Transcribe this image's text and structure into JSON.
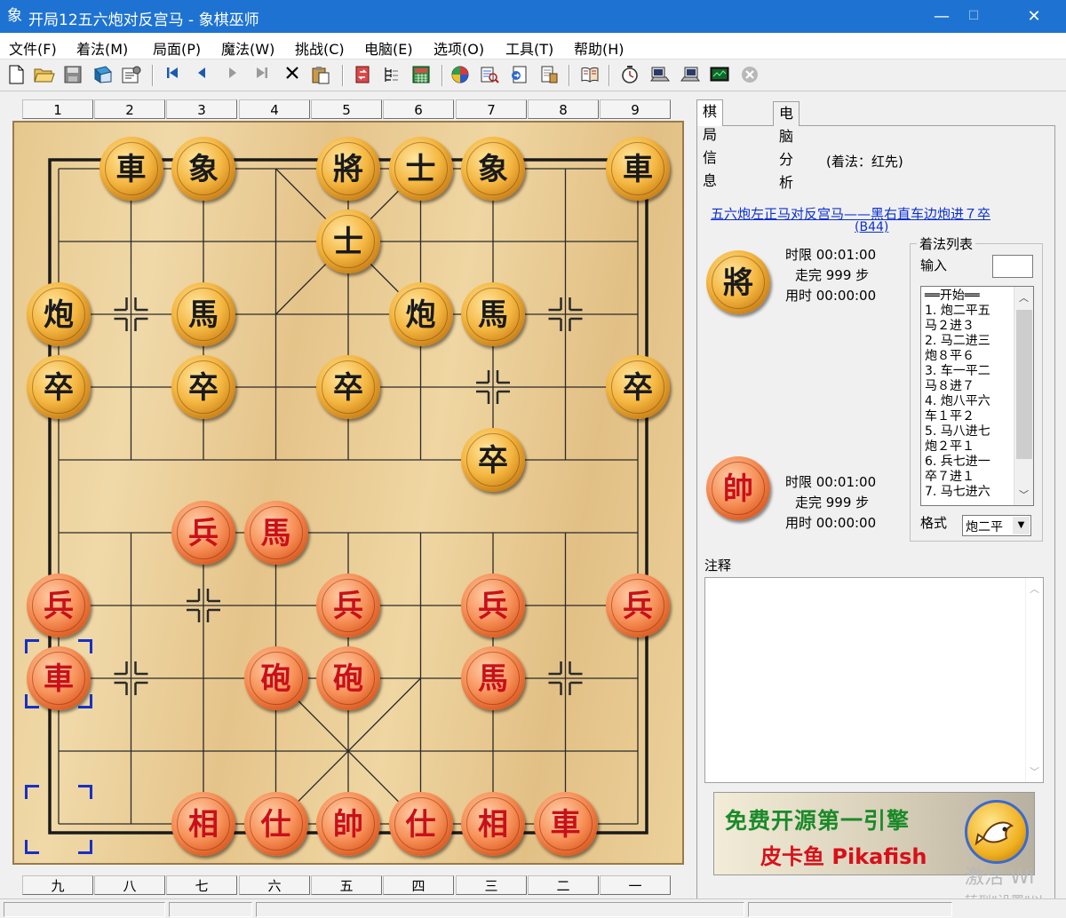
{
  "window": {
    "app_icon": "象",
    "title": "开局12五六炮对反宫马 - 象棋巫师",
    "minimize": "—",
    "maximize": "☐",
    "close": "✕"
  },
  "menu": [
    "文件(F)",
    "着法(M)",
    "局面(P)",
    "魔法(W)",
    "挑战(C)",
    "电脑(E)",
    "选项(O)",
    "工具(T)",
    "帮助(H)"
  ],
  "toolbar": {
    "icons": [
      "new-icon",
      "open-icon",
      "save-icon",
      "book-icon",
      "properties-icon",
      "first-move-icon",
      "prev-move-icon",
      "next-move-icon",
      "last-move-icon",
      "delete-icon",
      "paste-icon",
      "flip-icon",
      "tree-icon",
      "calc-icon",
      "engine-icon",
      "analyze-icon",
      "export-icon",
      "print-icon",
      "library-icon",
      "clock-icon",
      "machine-icon",
      "machine2-icon",
      "monitor-icon",
      "stop-icon"
    ]
  },
  "board": {
    "top_numbers": [
      "1",
      "2",
      "3",
      "4",
      "5",
      "6",
      "7",
      "8",
      "9"
    ],
    "bottom_numbers": [
      "九",
      "八",
      "七",
      "六",
      "五",
      "四",
      "三",
      "二",
      "一"
    ],
    "black_pieces": [
      {
        "char": "車",
        "file": 1,
        "rank": 0
      },
      {
        "char": "象",
        "file": 2,
        "rank": 0
      },
      {
        "char": "將",
        "file": 4,
        "rank": 0
      },
      {
        "char": "士",
        "file": 5,
        "rank": 0
      },
      {
        "char": "象",
        "file": 6,
        "rank": 0
      },
      {
        "char": "車",
        "file": 8,
        "rank": 0
      },
      {
        "char": "士",
        "file": 4,
        "rank": 1
      },
      {
        "char": "炮",
        "file": 0,
        "rank": 2
      },
      {
        "char": "馬",
        "file": 2,
        "rank": 2
      },
      {
        "char": "炮",
        "file": 5,
        "rank": 2
      },
      {
        "char": "馬",
        "file": 6,
        "rank": 2
      },
      {
        "char": "卒",
        "file": 0,
        "rank": 3
      },
      {
        "char": "卒",
        "file": 2,
        "rank": 3
      },
      {
        "char": "卒",
        "file": 4,
        "rank": 3
      },
      {
        "char": "卒",
        "file": 8,
        "rank": 3
      },
      {
        "char": "卒",
        "file": 6,
        "rank": 4
      }
    ],
    "red_pieces": [
      {
        "char": "兵",
        "file": 2,
        "rank": 5
      },
      {
        "char": "馬",
        "file": 3,
        "rank": 5
      },
      {
        "char": "兵",
        "file": 0,
        "rank": 6
      },
      {
        "char": "兵",
        "file": 4,
        "rank": 6
      },
      {
        "char": "兵",
        "file": 6,
        "rank": 6
      },
      {
        "char": "兵",
        "file": 8,
        "rank": 6
      },
      {
        "char": "車",
        "file": 0,
        "rank": 7
      },
      {
        "char": "砲",
        "file": 3,
        "rank": 7
      },
      {
        "char": "砲",
        "file": 4,
        "rank": 7
      },
      {
        "char": "馬",
        "file": 6,
        "rank": 7
      },
      {
        "char": "相",
        "file": 2,
        "rank": 9
      },
      {
        "char": "仕",
        "file": 3,
        "rank": 9
      },
      {
        "char": "帥",
        "file": 4,
        "rank": 9
      },
      {
        "char": "仕",
        "file": 5,
        "rank": 9
      },
      {
        "char": "相",
        "file": 6,
        "rank": 9
      },
      {
        "char": "車",
        "file": 7,
        "rank": 9
      }
    ]
  },
  "tabs": [
    "棋局信息",
    "电脑分析"
  ],
  "info": {
    "move_side": "(着法：红先)",
    "opening_name": "五六炮左正马对反宫马——黑右直车边炮进７卒",
    "opening_code": "(B44)",
    "black_badge": "將",
    "red_badge": "帥",
    "black_time_limit": "时限  00:01:00",
    "black_moves": "走完  999  步",
    "black_used": "用时  00:00:00",
    "red_time_limit": "时限  00:01:00",
    "red_moves": "走完  999  步",
    "red_used": "用时  00:00:00"
  },
  "movelist": {
    "title": "着法列表",
    "input_label": "输入",
    "input_value": "",
    "rows": [
      "══开始══",
      "1. 炮二平五",
      "   马２进３",
      "2. 马二进三",
      "   炮８平６",
      "3. 车一平二",
      "   马８进７",
      "4. 炮八平六",
      "   车１平２",
      "5. 马八进七",
      "   炮２平１",
      "6. 兵七进一",
      "   卒７进１",
      "7. 马七进六"
    ],
    "format_label": "格式",
    "format_value": "炮二平"
  },
  "notes_label": "注释",
  "banner": {
    "line1": "免费开源第一引擎",
    "line2": "皮卡鱼 Pikafish"
  },
  "watermark": {
    "line1": "激活 Wi",
    "line2": "转到\"设置\"以"
  }
}
